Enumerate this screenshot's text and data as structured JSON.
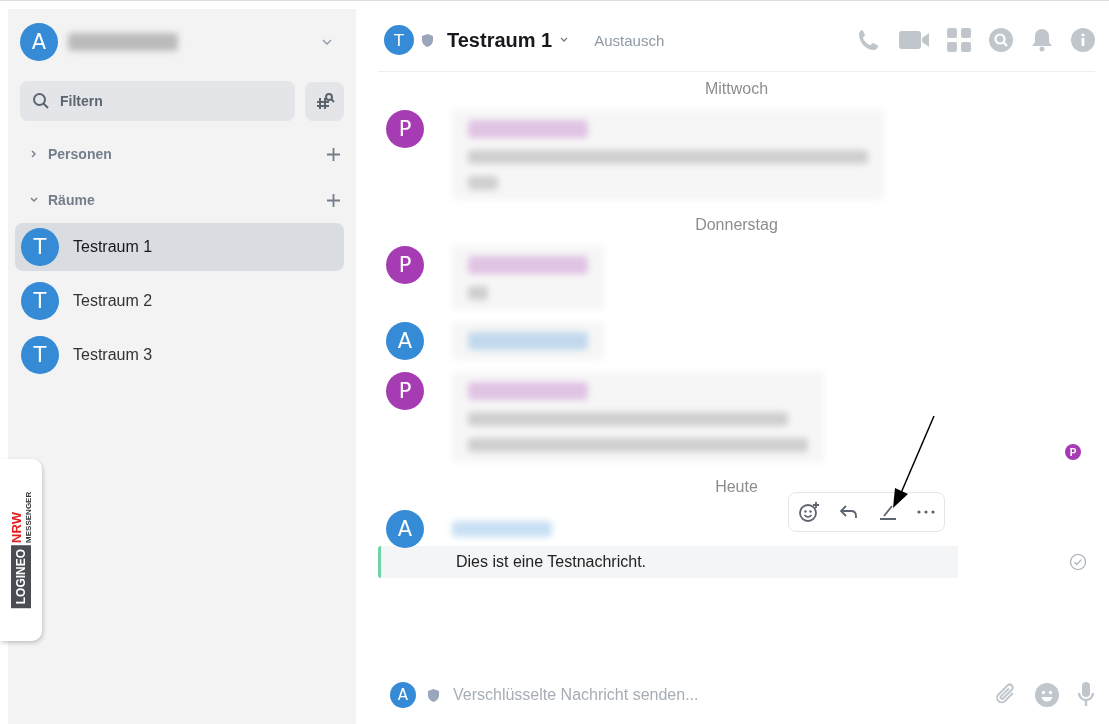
{
  "sidebar": {
    "account": {
      "avatar": "A"
    },
    "filter": {
      "placeholder": "Filtern"
    },
    "sections": [
      {
        "label": "Personen",
        "expanded": false
      },
      {
        "label": "Räume",
        "expanded": true
      }
    ],
    "rooms": [
      {
        "avatar": "T",
        "name": "Testraum 1",
        "selected": true
      },
      {
        "avatar": "T",
        "name": "Testraum 2",
        "selected": false
      },
      {
        "avatar": "T",
        "name": "Testraum 3",
        "selected": false
      }
    ],
    "logo": {
      "part_1": "LOGINEO",
      "part_2": "NRW",
      "part_3": "MESSENGER"
    }
  },
  "room_header": {
    "avatar": "T",
    "title": "Testraum 1",
    "topic": "Austausch"
  },
  "timeline": [
    {
      "kind": "date",
      "text": "Mittwoch"
    },
    {
      "kind": "message",
      "avatar": "P",
      "color": "#a63cb3"
    },
    {
      "kind": "date",
      "text": "Donnerstag"
    },
    {
      "kind": "message",
      "avatar": "P",
      "color": "#a63cb3"
    },
    {
      "kind": "message",
      "avatar": "A",
      "color": "#368bd6"
    },
    {
      "kind": "message",
      "avatar": "P",
      "color": "#a63cb3",
      "read_by": "P"
    },
    {
      "kind": "date",
      "text": "Heute"
    },
    {
      "kind": "message",
      "avatar": "A",
      "color": "#368bd6",
      "text": "Dies ist eine Testnachricht.",
      "hovered": true
    }
  ],
  "composer": {
    "avatar": "A",
    "placeholder": "Verschlüsselte Nachricht senden..."
  }
}
